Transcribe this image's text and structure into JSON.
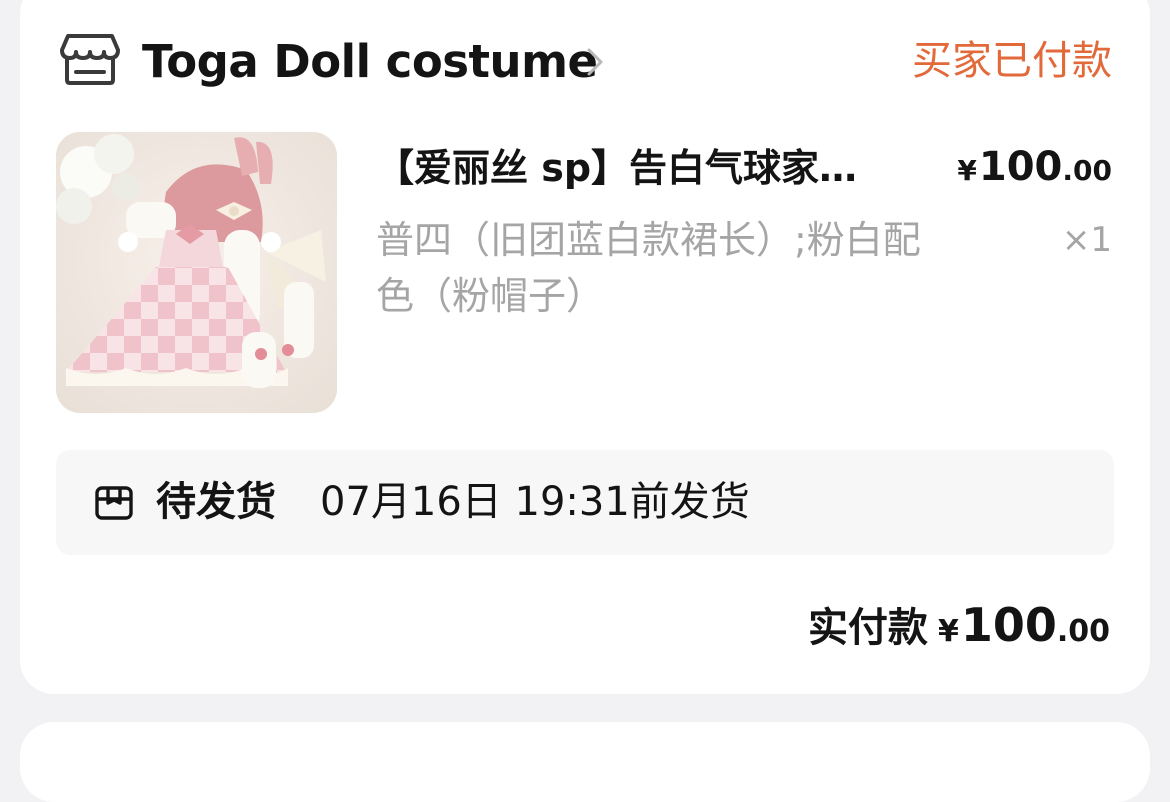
{
  "shop": {
    "name": "Toga Doll costume",
    "status": "买家已付款"
  },
  "product": {
    "title": "【爱丽丝 sp】告白气球家…",
    "price_currency": "¥",
    "price_int": "100",
    "price_dec": ".00",
    "sku": "普四（旧团蓝白款裙长）;粉白配色（粉帽子）",
    "quantity": "×1",
    "image_description_icon": "doll-dress-image"
  },
  "shipping": {
    "status": "待发货",
    "deadline": "07月16日 19:31前发货"
  },
  "total": {
    "label": "实付款",
    "currency": "¥",
    "amount_int": "100",
    "amount_dec": ".00"
  },
  "colors": {
    "status_accent": "#e2693a",
    "text_primary": "#141414",
    "text_secondary": "#a5a5a5",
    "card_bg": "#ffffff",
    "page_bg": "#f2f2f4",
    "ship_bar_bg": "#f7f7f8"
  }
}
